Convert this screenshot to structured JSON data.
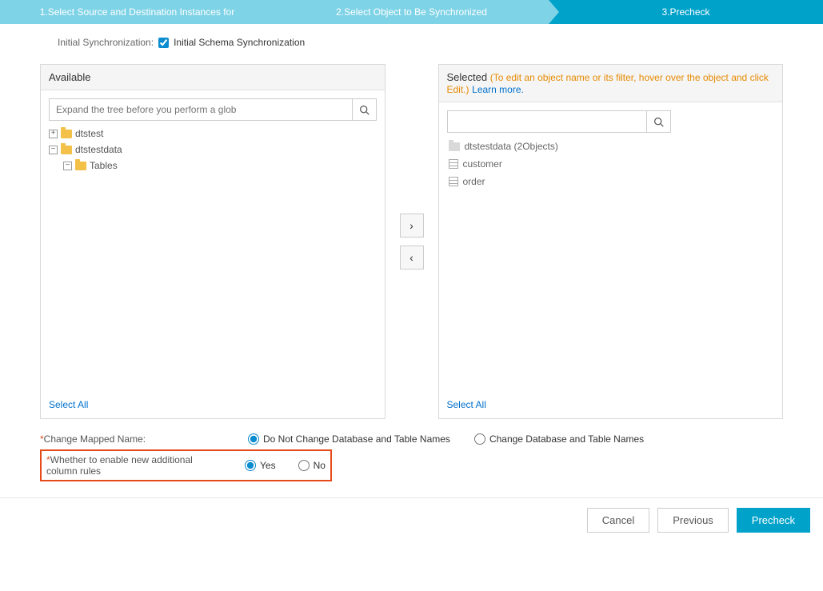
{
  "wizard": {
    "step1": "1.Select Source and Destination Instances for",
    "step2": "2.Select Object to Be Synchronized",
    "step3": "3.Precheck"
  },
  "initSync": {
    "label": "Initial Synchronization:",
    "option": "Initial Schema Synchronization"
  },
  "available": {
    "title": "Available",
    "searchPlaceholder": "Expand the tree before you perform a glob",
    "tree": {
      "node1": "dtstest",
      "node2": "dtstestdata",
      "node3": "Tables"
    },
    "selectAll": "Select All"
  },
  "selected": {
    "title": "Selected",
    "hint": "(To edit an object name or its filter, hover over the object and click Edit.)",
    "learnMore": "Learn more.",
    "list": {
      "db": "dtstestdata (2Objects)",
      "t1": "customer",
      "t2": "order"
    },
    "selectAll": "Select All"
  },
  "form": {
    "mappedLabel": "Change Mapped Name:",
    "mappedOpt1": "Do Not Change Database and Table Names",
    "mappedOpt2": "Change Database and Table Names",
    "rulesLabel": "Whether to enable new additional column rules",
    "yes": "Yes",
    "no": "No"
  },
  "footer": {
    "cancel": "Cancel",
    "previous": "Previous",
    "precheck": "Precheck"
  }
}
